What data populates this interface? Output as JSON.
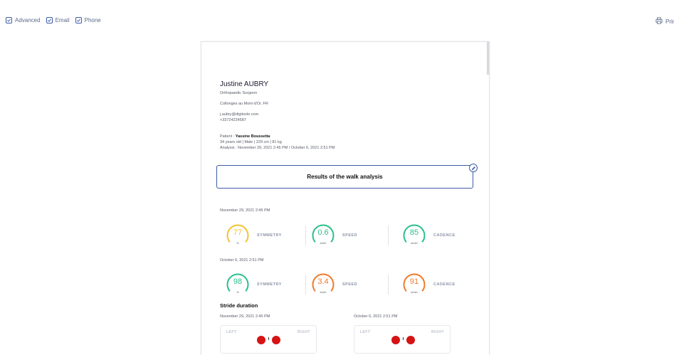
{
  "toolbar": {
    "options": [
      {
        "label": "Advanced",
        "checked": true
      },
      {
        "label": "Email",
        "checked": true
      },
      {
        "label": "Phone",
        "checked": true
      }
    ],
    "print_label": "Prin",
    "print_icon": "printer-icon"
  },
  "doctor": {
    "name": "Justine AUBRY",
    "title": "Orthopaedic Surgeon",
    "location": "Collonges au Mont-d'Or, FR",
    "email": "j.aubry@digitsole.com",
    "phone": "+33724224587"
  },
  "patient": {
    "prefix": "Patient : ",
    "name": "Yassine Boussetta",
    "details": "34 years old  |  Male  |  229 cm  |  81 kg",
    "analysis": "Analysis : November 29, 2021 2:45 PM / October 6, 2021 2:51 PM"
  },
  "results_title": "Results of the walk analysis",
  "analyses": [
    {
      "date": "November 29, 2021 2:45 PM",
      "metrics": [
        {
          "value": "77",
          "unit": "%",
          "label": "SYMMETRY",
          "color": "#f5c230"
        },
        {
          "value": "0.6",
          "unit": "km/h",
          "label": "SPEED",
          "color": "#2bbf8a"
        },
        {
          "value": "85",
          "unit": "s/min",
          "label": "CADENCE",
          "color": "#2bbf8a"
        }
      ]
    },
    {
      "date": "October 6, 2021 2:51 PM",
      "metrics": [
        {
          "value": "98",
          "unit": "%",
          "label": "SYMMETRY",
          "color": "#2bbf8a"
        },
        {
          "value": "3.4",
          "unit": "km/h",
          "label": "SPEED",
          "color": "#f07a2c"
        },
        {
          "value": "91",
          "unit": "s/min",
          "label": "CADENCE",
          "color": "#f07a2c"
        }
      ]
    }
  ],
  "stride": {
    "title": "Stride duration",
    "cards": [
      {
        "date": "November 29, 2021 2:45 PM",
        "left": "LEFT",
        "right": "RIGHT"
      },
      {
        "date": "October 6, 2021 2:51 PM",
        "left": "LEFT",
        "right": "RIGHT"
      }
    ]
  },
  "colors": {
    "accent": "#3b5ba9",
    "green": "#2bbf8a",
    "yellow": "#f5c230",
    "orange": "#f07a2c",
    "red": "#d61313"
  }
}
